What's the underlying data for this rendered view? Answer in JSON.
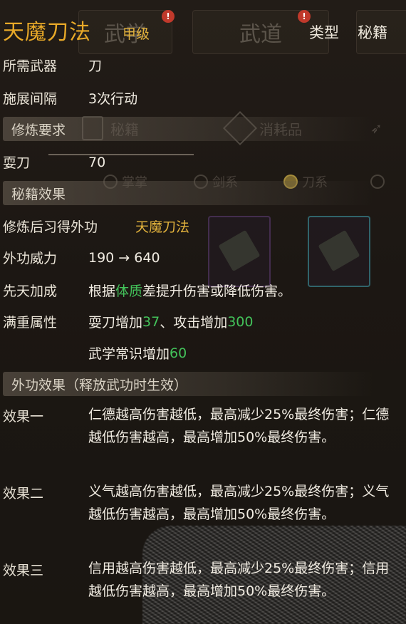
{
  "background": {
    "tabs": [
      "武学",
      "武道"
    ],
    "categories": [
      "秘籍",
      "消耗品"
    ],
    "filters": [
      "掌掌",
      "剑系",
      "刀系"
    ]
  },
  "tooltip": {
    "title": "天魔刀法",
    "grade": "甲级",
    "type_label": "类型",
    "type_value": "秘籍",
    "required_weapon_label": "所需武器",
    "required_weapon_value": "刀",
    "cast_interval_label": "施展间隔",
    "cast_interval_value": "3次行动",
    "section_requirements": "修炼要求",
    "req_skill_label": "耍刀",
    "req_skill_value": "70",
    "section_effects": "秘籍效果",
    "learn_label": "修炼后习得外功",
    "learn_value": "天魔刀法",
    "power_label": "外功威力",
    "power_value": "190 → 640",
    "innate_label": "先天加成",
    "innate_prefix": "根据",
    "innate_attr": "体质",
    "innate_suffix": "差提升伤害或降低伤害。",
    "full_label": "满重属性",
    "full_line1_a": "耍刀增加 ",
    "full_line1_v1": "37",
    "full_line1_b": "、攻击增加 ",
    "full_line1_v2": "300",
    "full_line2_a": "武学常识增加 ",
    "full_line2_v": "60",
    "section_external": "外功效果（释放武功时生效）",
    "effects": [
      {
        "label": "效果一",
        "text": "仁德越高伤害越低，最高减少25%最终伤害；仁德越低伤害越高，最高增加50%最终伤害。"
      },
      {
        "label": "效果二",
        "text": "义气越高伤害越低，最高减少25%最终伤害；义气越低伤害越高，最高增加50%最终伤害。"
      },
      {
        "label": "效果三",
        "text": "信用越高伤害越低，最高减少25%最终伤害；信用越低伤害越高，最高增加50%最终伤害。"
      }
    ]
  },
  "colors": {
    "title": "#e8a928",
    "highlight": "#e1b13c",
    "bonus": "#43c25a",
    "text": "#f1ece2"
  }
}
